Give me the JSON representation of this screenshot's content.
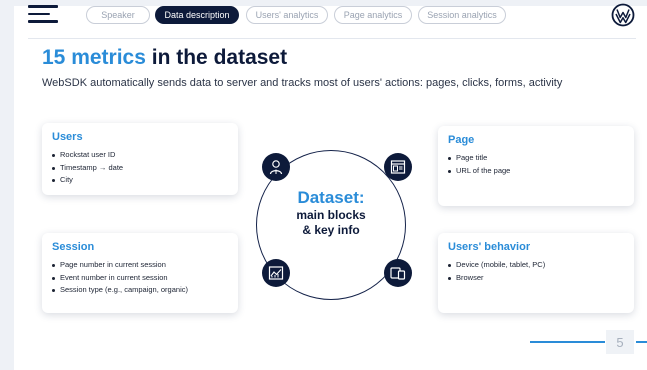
{
  "nav": {
    "tabs": [
      {
        "label": "Speaker"
      },
      {
        "label": "Data description"
      },
      {
        "label": "Users' analytics"
      },
      {
        "label": "Page analytics"
      },
      {
        "label": "Session analytics"
      }
    ],
    "active_tab": "Data description"
  },
  "title": {
    "accent": "15 metrics",
    "rest": " in the dataset"
  },
  "subtitle": "WebSDK automatically sends data to server and tracks most of users' actions: pages, clicks, forms, activity",
  "center": {
    "line1": "Dataset:",
    "line2": "main blocks",
    "line3": "& key info"
  },
  "cards": {
    "users": {
      "title": "Users",
      "items": [
        "Rockstat user ID",
        "Timestamp → date",
        "City"
      ]
    },
    "session": {
      "title": "Session",
      "items": [
        "Page number in current session",
        "Event number in current session",
        "Session type (e.g., campaign, organic)"
      ]
    },
    "page": {
      "title": "Page",
      "items": [
        "Page title",
        "URL of the page"
      ]
    },
    "behavior": {
      "title": "Users' behavior",
      "items": [
        "Device (mobile, tablet, PC)",
        "Browser"
      ]
    }
  },
  "icons": {
    "users": "user-icon",
    "page": "browser-window-icon",
    "session": "analytics-chart-icon",
    "behavior": "devices-icon",
    "logo": "vw-logo-icon",
    "menu": "hamburger-menu-icon"
  },
  "colors": {
    "accent": "#2a8cd8",
    "dark": "#0d1a3a"
  },
  "page_number": "5"
}
